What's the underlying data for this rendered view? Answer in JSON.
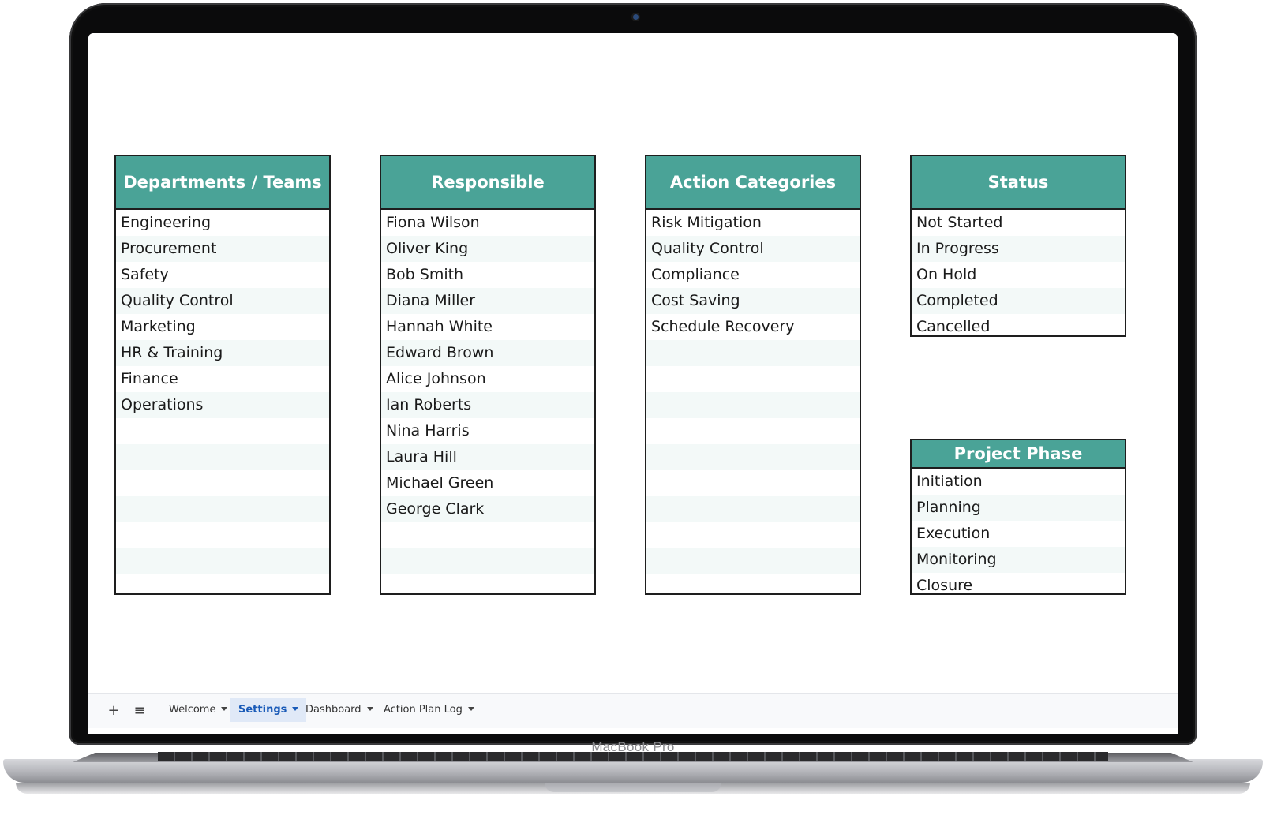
{
  "device": {
    "label": "MacBook Pro"
  },
  "tables": {
    "departments": {
      "header": "Departments / Teams",
      "items": [
        "Engineering",
        "Procurement",
        "Safety",
        "Quality Control",
        "Marketing",
        "HR & Training",
        "Finance",
        "Operations",
        "",
        "",
        "",
        "",
        "",
        "",
        ""
      ]
    },
    "responsible": {
      "header": "Responsible",
      "items": [
        "Fiona Wilson",
        "Oliver King",
        "Bob Smith",
        "Diana Miller",
        "Hannah White",
        "Edward Brown",
        "Alice Johnson",
        "Ian Roberts",
        "Nina Harris",
        "Laura Hill",
        "Michael Green",
        "George Clark",
        "",
        "",
        ""
      ]
    },
    "categories": {
      "header": "Action Categories",
      "items": [
        "Risk Mitigation",
        "Quality Control",
        "Compliance",
        "Cost Saving",
        "Schedule Recovery",
        "",
        "",
        "",
        "",
        "",
        "",
        "",
        "",
        "",
        ""
      ]
    },
    "status": {
      "header": "Status",
      "items": [
        "Not Started",
        "In Progress",
        "On Hold",
        "Completed",
        "Cancelled"
      ]
    },
    "phase": {
      "header": "Project Phase",
      "items": [
        "Initiation",
        "Planning",
        "Execution",
        "Monitoring",
        "Closure"
      ]
    }
  },
  "sheet_bar": {
    "add_icon": "+",
    "menu_icon": "≡",
    "tabs": [
      {
        "label": "Welcome",
        "active": false
      },
      {
        "label": "Settings",
        "active": true
      },
      {
        "label": "Dashboard",
        "active": false
      },
      {
        "label": "Action Plan Log",
        "active": false
      }
    ]
  },
  "colors": {
    "header_bg": "#4aa397",
    "active_tab": "#1a5bb8"
  }
}
